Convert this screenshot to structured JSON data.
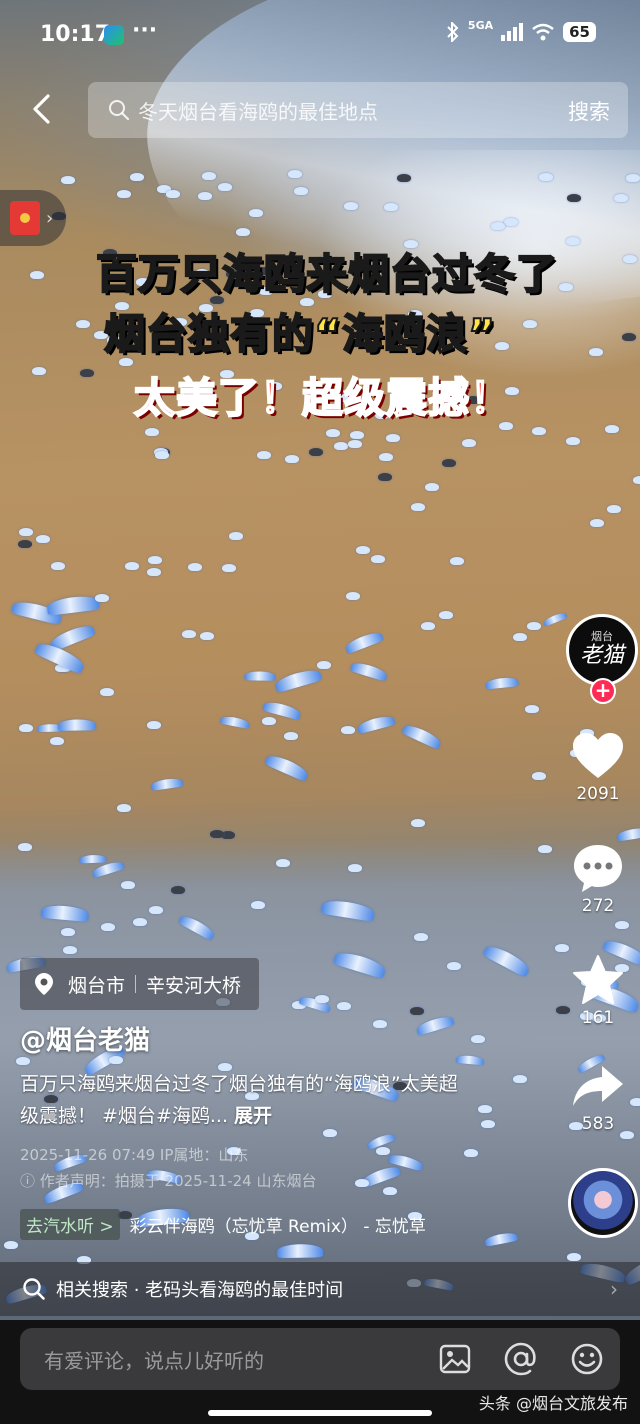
{
  "status_bar": {
    "time": "10:17",
    "dots": "···",
    "network": "5GA",
    "battery": "65"
  },
  "search": {
    "query": "冬天烟台看海鸥的最佳地点",
    "button": "搜索"
  },
  "captions": {
    "line1": "百万只海鸥来烟台过冬了",
    "line2": "烟台独有的“海鸥浪”",
    "line3": "太美了！超级震撼！"
  },
  "author_avatar": {
    "small": "烟台",
    "big": "老猫"
  },
  "actions": {
    "likes": "2091",
    "comments": "272",
    "favorites": "161",
    "shares": "583"
  },
  "location": {
    "city": "烟台市",
    "place": "辛安河大桥"
  },
  "author": "@烟台老猫",
  "description": {
    "text": "百万只海鸥来烟台过冬了烟台独有的“海鸥浪”太美超级震撼！ #烟台#海鸥...",
    "more": "展开"
  },
  "meta": {
    "line1": "2025-11-26 07:49 IP属地：山东",
    "line2": "作者声明：拍摄于 2025-11-24 山东烟台"
  },
  "music": {
    "tag": "去汽水听 >",
    "title": "彩云伴海鸥（忘忧草 Remix） - 忘忧草"
  },
  "related_search": {
    "text": "相关搜索 · 老码头看海鸥的最佳时间"
  },
  "comment": {
    "placeholder": "有爱评论，说点儿好听的"
  },
  "watermark": "头条 @烟台文旅发布",
  "icons": {
    "back": "back-arrow-icon",
    "search": "search-icon",
    "like": "heart-icon",
    "comment": "comment-bubble-icon",
    "favorite": "star-icon",
    "share": "share-arrow-icon",
    "location": "location-pin-icon",
    "image": "image-icon",
    "mention": "at-icon",
    "emoji": "emoji-icon"
  },
  "colors": {
    "caption_yellow": "#ffe44a",
    "caption_red": "#ff3b2f",
    "follow_red": "#fe2c55"
  }
}
